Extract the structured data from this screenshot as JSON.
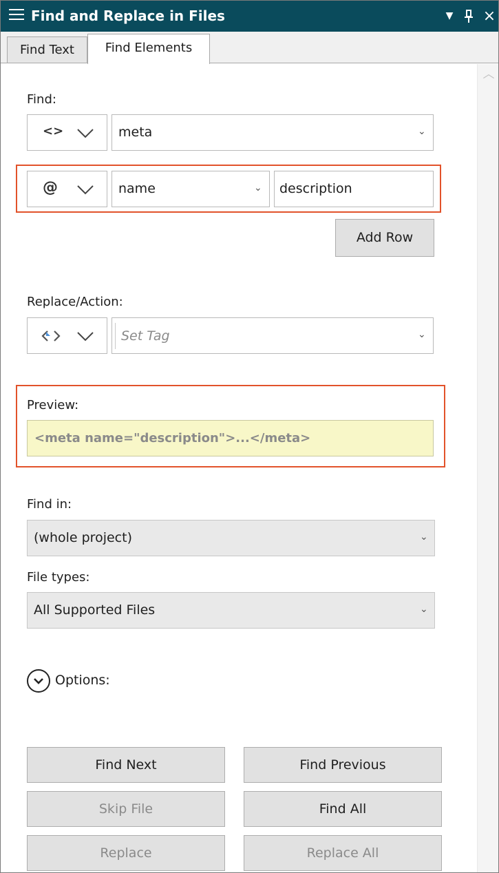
{
  "titlebar": {
    "title": "Find and Replace in Files",
    "dropdown_glyph": "▼",
    "pin_glyph": "ᵖ",
    "close_glyph": "×"
  },
  "tabs": [
    {
      "label": "Find Text",
      "active": false
    },
    {
      "label": "Find Elements",
      "active": true
    }
  ],
  "find": {
    "label": "Find:",
    "tag_type_glyph": "<>",
    "tag_value": "meta",
    "attr_type_glyph": "@",
    "attr_name": "name",
    "attr_value": "description",
    "add_row_label": "Add Row"
  },
  "replace": {
    "label": "Replace/Action:",
    "action_placeholder": "Set Tag"
  },
  "preview": {
    "label": "Preview:",
    "text": "<meta name=\"description\">...</meta>"
  },
  "find_in": {
    "label": "Find in:",
    "value": "(whole project)"
  },
  "file_types": {
    "label": "File types:",
    "value": "All Supported Files"
  },
  "options": {
    "label": "Options:"
  },
  "buttons": {
    "find_next": "Find Next",
    "find_previous": "Find Previous",
    "skip_file": "Skip File",
    "find_all": "Find All",
    "replace": "Replace",
    "replace_all": "Replace All"
  },
  "colors": {
    "titlebar": "#0a4b5c",
    "highlight": "#e2522a",
    "preview_bg": "#f8f7c8"
  }
}
